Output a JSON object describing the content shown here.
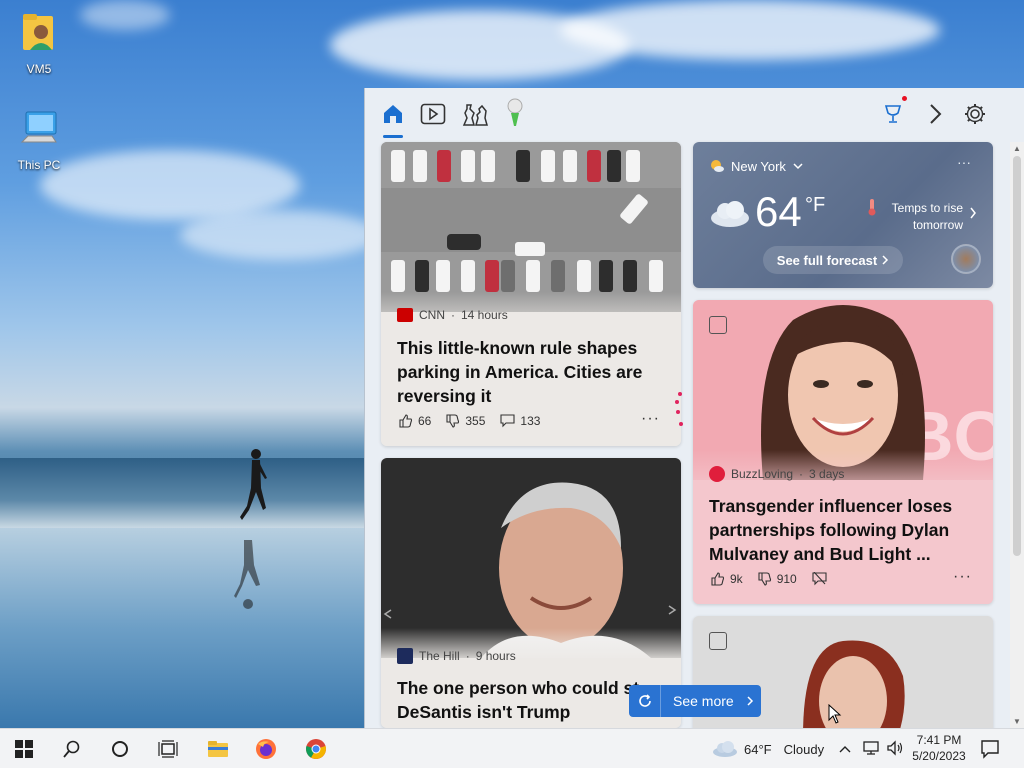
{
  "desktop": {
    "icons": [
      {
        "label": "VM5"
      },
      {
        "label": "This PC"
      }
    ]
  },
  "widgets": {
    "tabs": [
      "home-icon",
      "video-icon",
      "chess-icon",
      "golf-icon"
    ],
    "weather": {
      "location": "New York",
      "temperature": "64",
      "unit": "°F",
      "note_line1": "Temps to rise",
      "note_line2": "tomorrow",
      "forecast_link": "See full forecast"
    },
    "articles": [
      {
        "source": "CNN",
        "age": "14 hours",
        "title": "This little-known rule shapes parking in America. Cities are reversing it",
        "likes": "66",
        "dislikes": "355",
        "comments": "133"
      },
      {
        "source": "BuzzLoving",
        "age": "3 days",
        "title": "Transgender influencer loses partnerships following Dylan Mulvaney and Bud Light ...",
        "likes": "9k",
        "dislikes": "910"
      },
      {
        "source": "The Hill",
        "age": "9 hours",
        "title_line1": "The one person who could st",
        "title_line2": "DeSantis isn't Trump"
      }
    ],
    "see_more": "See more"
  },
  "taskbar": {
    "weather_temp": "64°F",
    "weather_cond": "Cloudy",
    "time": "7:41 PM",
    "date": "5/20/2023"
  },
  "colors": {
    "accent": "#1b6fd0",
    "weather_card": "#5c6f8e",
    "pink_card": "#f3c6cc",
    "see_more_bg": "#2a73d2"
  }
}
